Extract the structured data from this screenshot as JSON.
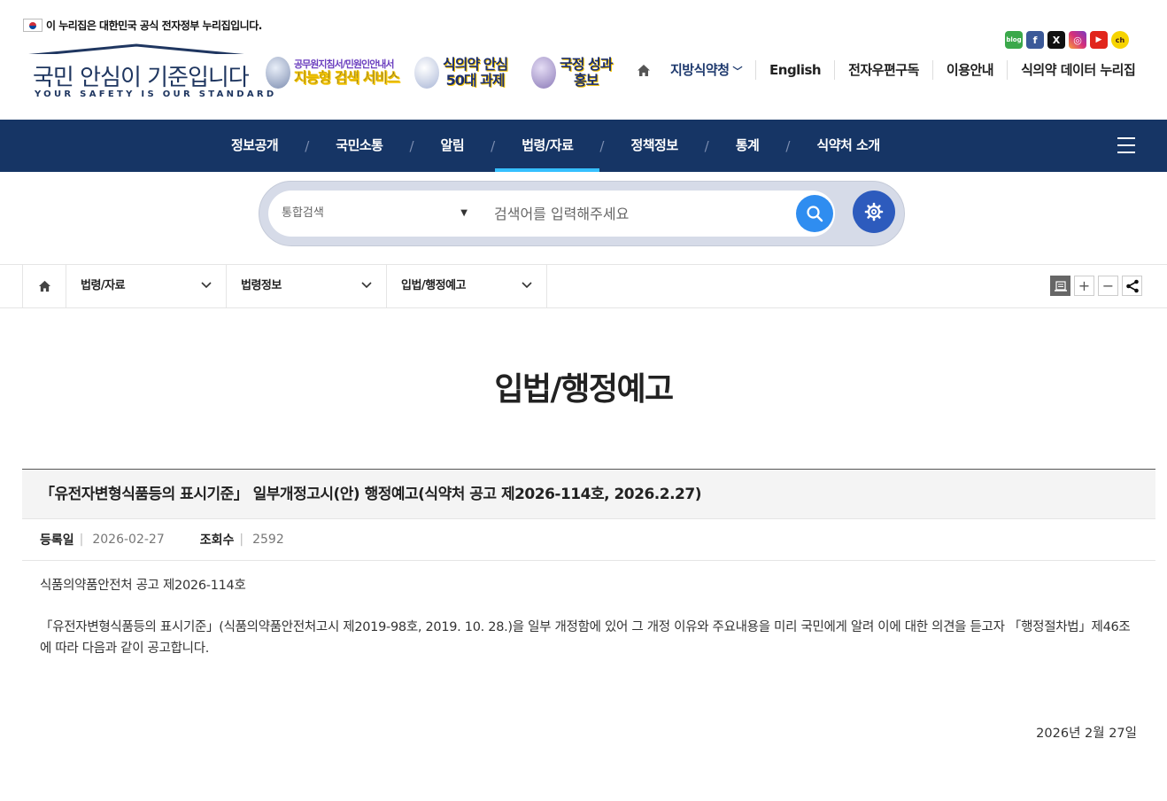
{
  "gov_banner": {
    "text": "이 누리집은 대한민국 공식 전자정부 누리집입니다."
  },
  "logo": {
    "title": "국민 안심이 기준입니다",
    "subtitle": "YOUR SAFETY IS OUR STANDARD"
  },
  "promos": [
    {
      "line1": "공무원지침서/민원인안내서",
      "line2": "지능형 검색 서비스"
    },
    {
      "line1": "식의약 안심",
      "line2": "50대 과제"
    },
    {
      "line1": "국정 성과",
      "line2": "홍보"
    }
  ],
  "social": [
    {
      "icon": "blog-icon",
      "label": "blog",
      "color": "#3aa84a"
    },
    {
      "icon": "facebook-icon",
      "label": "f",
      "color": "#3b5998"
    },
    {
      "icon": "x-icon",
      "label": "X",
      "color": "#111111"
    },
    {
      "icon": "instagram-icon",
      "label": "◎",
      "color": "#d6307a"
    },
    {
      "icon": "youtube-icon",
      "label": "▶",
      "color": "#e1251b"
    },
    {
      "icon": "kakao-icon",
      "label": "ch",
      "color": "#f7d400"
    }
  ],
  "util_nav": {
    "items": [
      "지방식약청",
      "English",
      "전자우편구독",
      "이용안내",
      "식의약 데이터 누리집"
    ]
  },
  "gnb": {
    "items": [
      "정보공개",
      "국민소통",
      "알림",
      "법령/자료",
      "정책정보",
      "통계",
      "식약처 소개"
    ],
    "active_index": 3,
    "separator": "/"
  },
  "search": {
    "scope": "통합검색",
    "placeholder": "검색어를 입력해주세요"
  },
  "breadcrumb": {
    "items": [
      "법령/자료",
      "법령정보",
      "입법/행정예고"
    ]
  },
  "page_title": "입법/행정예고",
  "article": {
    "title": "「유전자변형식품등의 표시기준」 일부개정고시(안) 행정예고(식약처 공고 제2026-114호, 2026.2.27)",
    "meta": {
      "date_label": "등록일",
      "date_value": "2026-02-27",
      "views_label": "조회수",
      "views_value": "2592"
    },
    "body": [
      "식품의약품안전처 공고 제2026-114호",
      "「유전자변형식품등의 표시기준」(식품의약품안전처고시 제2019-98호, 2019. 10. 28.)을 일부 개정함에 있어 그 개정 이유와 주요내용을 미리 국민에게 알려 이에 대한 의견을 듣고자 「행정절차법」제46조에 따라 다음과 같이 공고합니다."
    ],
    "footer_date": "2026년 2월 27일"
  },
  "colors": {
    "gnb_bg": "#163565",
    "gnb_active": "#36c0ff",
    "search_btn": "#2f8df0",
    "setting_btn": "#2d5bbd",
    "brand": "#1f3660"
  }
}
